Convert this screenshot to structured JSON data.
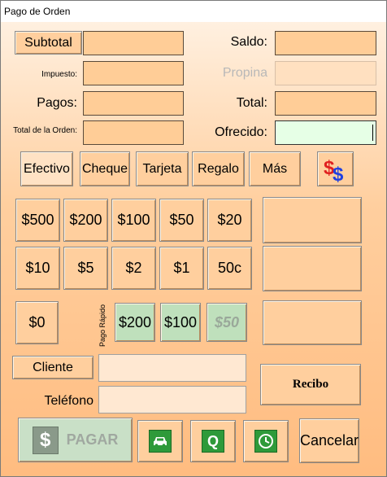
{
  "window": {
    "title": "Pago de Orden"
  },
  "labels": {
    "impuesto": "Impuesto:",
    "pagos": "Pagos:",
    "total_orden": "Total de la Orden:",
    "saldo": "Saldo:",
    "propina": "Propina",
    "total": "Total:",
    "ofrecido": "Ofrecido:",
    "telefono": "Teléfono",
    "pago_rapido": "Pago Rápido"
  },
  "buttons": {
    "subtotal": "Subtotal",
    "cliente": "Cliente",
    "recibo": "Recibo",
    "pagar": "PAGAR",
    "cancelar": "Cancelar"
  },
  "fields": {
    "subtotal": "",
    "impuesto": "",
    "pagos": "",
    "total_orden": "",
    "saldo": "",
    "propina": "",
    "total": "",
    "ofrecido": "",
    "cliente": "",
    "telefono": ""
  },
  "payment_tabs": [
    "Efectivo",
    "Cheque",
    "Tarjeta",
    "Regalo",
    "Más"
  ],
  "selected_tab": "Efectivo",
  "denominations": {
    "row1": [
      "$500",
      "$200",
      "$100",
      "$50",
      "$20"
    ],
    "row2": [
      "$10",
      "$5",
      "$2",
      "$1",
      "50c"
    ],
    "zero": "$0"
  },
  "quick_pay": [
    "$200",
    "$100",
    "$50"
  ],
  "icons": {
    "currency": "dollar-currency-icon",
    "pay": "dollar-icon",
    "car": "car-icon",
    "queue": "q-icon",
    "timer": "clock-icon"
  }
}
